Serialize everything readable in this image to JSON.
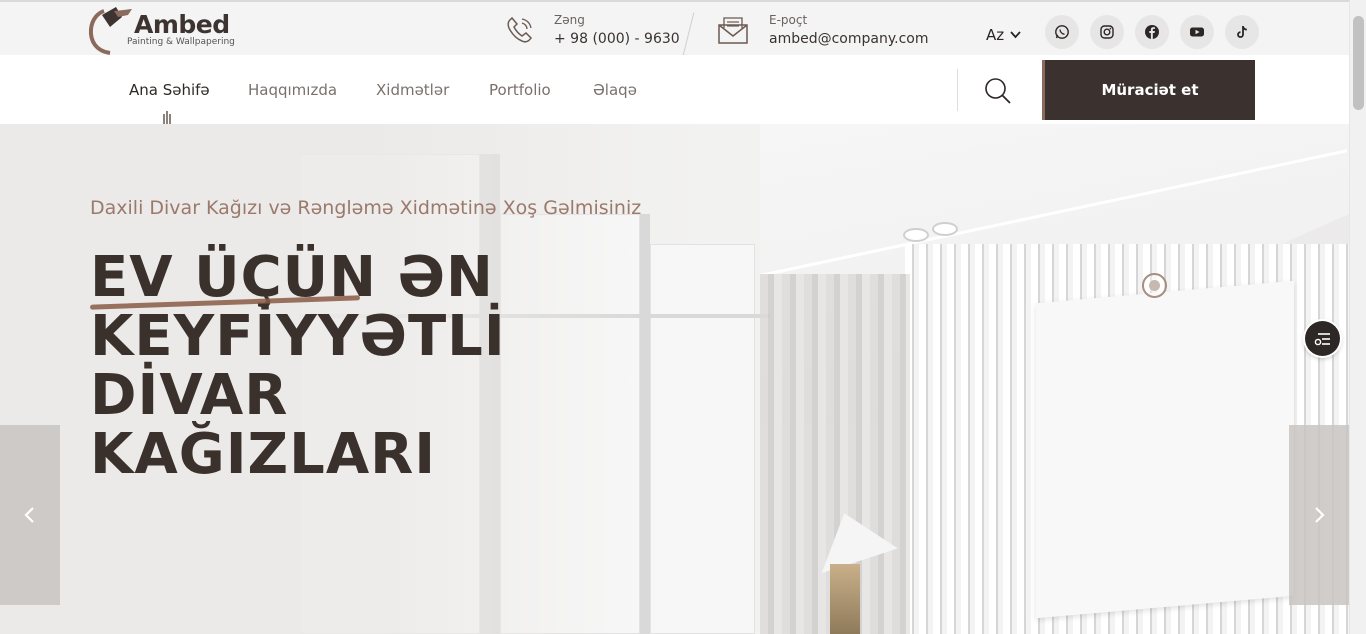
{
  "brand": {
    "name": "Ambed",
    "tagline": "Painting & Wallpapering",
    "accent_color": "#8a6a5c",
    "dark_color": "#3b3230"
  },
  "contacts": {
    "phone": {
      "label": "Zəng",
      "value": "+ 98 (000) - 9630",
      "icon": "phone-icon"
    },
    "email": {
      "label": "E-poçt",
      "value": "ambed@company.com",
      "icon": "envelope-icon"
    }
  },
  "language": {
    "selected": "Az"
  },
  "social": [
    {
      "name": "whatsapp-icon"
    },
    {
      "name": "instagram-icon"
    },
    {
      "name": "facebook-icon"
    },
    {
      "name": "youtube-icon"
    },
    {
      "name": "tiktok-icon"
    }
  ],
  "nav": {
    "items": [
      {
        "label": "Ana Səhifə",
        "active": true
      },
      {
        "label": "Haqqımızda"
      },
      {
        "label": "Xidmətlər"
      },
      {
        "label": "Portfolio"
      },
      {
        "label": "Əlaqə"
      }
    ],
    "cta_label": "Müraciət et"
  },
  "hero": {
    "subtitle": "Daxili Divar Kağızı və Rəngləmə Xidmətinə Xoş Gəlmisiniz",
    "title_line1_highlight": "EV ÜÇÜN",
    "title_line1_rest": " ƏN",
    "title_line2": "KEYFİYYƏTLİ",
    "title_line3": "DİVAR",
    "title_line4": "KAĞIZLARI"
  }
}
